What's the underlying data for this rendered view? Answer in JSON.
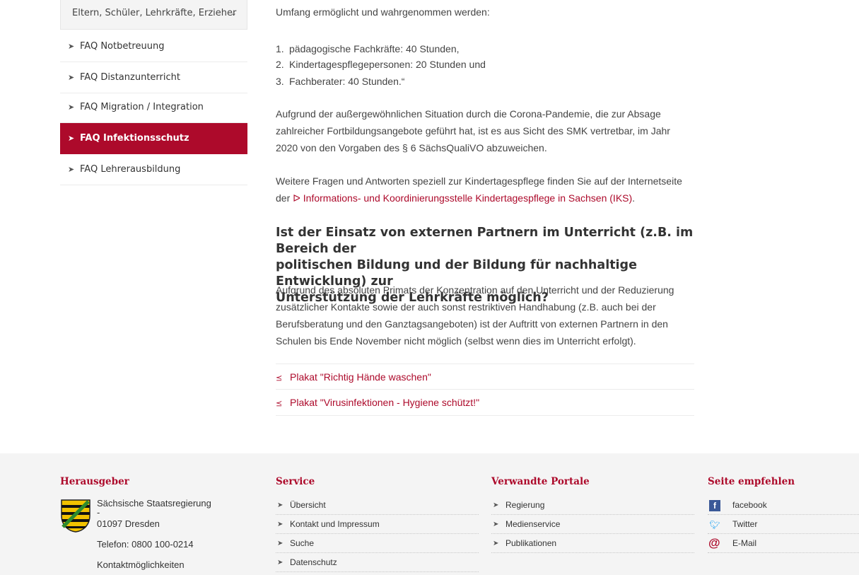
{
  "sidebar": {
    "dropdown_label": "Eltern, Schüler, Lehrkräfte, Erzieher",
    "items": [
      {
        "label": "FAQ Notbetreuung",
        "active": false
      },
      {
        "label": "FAQ Distanzunterricht",
        "active": false
      },
      {
        "label": "FAQ Migration / Integration",
        "active": false
      },
      {
        "label": "FAQ Infektionsschutz",
        "active": true
      },
      {
        "label": "FAQ Lehrerausbildung",
        "active": false
      }
    ]
  },
  "main": {
    "intro_cut": "Umfang ermöglicht und wahrgenommen werden:",
    "list": [
      {
        "num": "1.",
        "text": "pädagogische Fachkräfte: 40 Stunden,"
      },
      {
        "num": "2.",
        "text": "Kindertagespflegepersonen: 20 Stunden und"
      },
      {
        "num": "3.",
        "text": "Fachberater: 40 Stunden.“"
      }
    ],
    "para_corona": [
      "Aufgrund der außergewöhnlichen Situation durch die Corona-Pandemie, die zur Absage",
      "zahlreicher Fortbildungsangebote geführt hat, ist es aus Sicht des SMK vertretbar, im Jahr",
      "2020 von den Vorgaben des § 6 SächsQualiVO abzuweichen."
    ],
    "para_more_line1": "Weitere Fragen und Antworten speziell zur Kindertagespflege finden Sie auf der Internetseite",
    "para_more_prefix": "der ",
    "iks_link": "Informations- und Koordinierungsstelle Kindertagespflege in Sachsen (IKS)",
    "para_more_suffix": ".",
    "heading": [
      "Ist der Einsatz von externen Partnern im Unterricht (z.B. im Bereich der",
      "politischen Bildung und der Bildung für nachhaltige Entwicklung) zur",
      "Unterstützung der Lehrkräfte möglich?"
    ],
    "answer": [
      "Aufgrund des absoluten Primats der Konzentration auf den Unterricht und der Reduzierung",
      "zusätzlicher Kontakte sowie der auch sonst restriktiven Handhabung (z.B. auch bei der",
      "Berufsberatung und den Ganztagsangeboten) ist der Auftritt von externen Partnern in den",
      "Schulen bis Ende November nicht möglich (selbst wenn dies im Unterricht erfolgt)."
    ],
    "downloads": [
      "Plakat \"Richtig Hände waschen\"",
      "Plakat \"Virusinfektionen - Hygiene schützt!\""
    ]
  },
  "footer": {
    "publisher": {
      "heading": "Herausgeber",
      "name": "Sächsische Staatsregierung",
      "dash": "-",
      "city": "01097 Dresden",
      "phone": "Telefon: 0800 100-0214",
      "contact": "Kontaktmöglichkeiten"
    },
    "service": {
      "heading": "Service",
      "items": [
        "Übersicht",
        "Kontakt und Impressum",
        "Suche",
        "Datenschutz"
      ]
    },
    "portals": {
      "heading": "Verwandte Portale",
      "items": [
        "Regierung",
        "Medienservice",
        "Publikationen"
      ]
    },
    "share": {
      "heading": "Seite empfehlen",
      "items": [
        {
          "label": "facebook",
          "icon": "facebook-icon"
        },
        {
          "label": "Twitter",
          "icon": "twitter-icon"
        },
        {
          "label": "E-Mail",
          "icon": "email-icon"
        }
      ]
    }
  },
  "colors": {
    "accent": "#ad0a2b",
    "footer_bg": "#f4f4f4"
  }
}
